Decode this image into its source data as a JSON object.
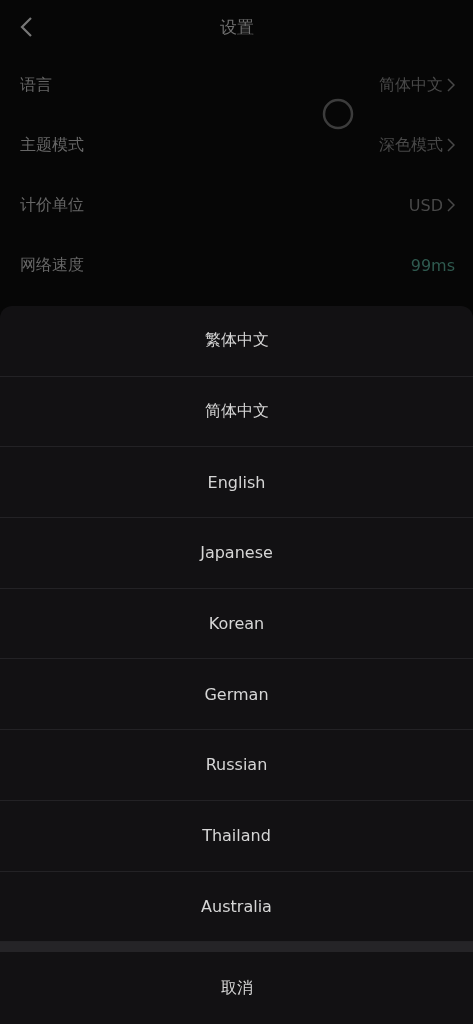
{
  "header": {
    "title": "设置"
  },
  "settings": [
    {
      "label": "语言",
      "value": "简体中文",
      "kind": "link"
    },
    {
      "label": "主题模式",
      "value": "深色模式",
      "kind": "link"
    },
    {
      "label": "计价单位",
      "value": "USD",
      "kind": "link"
    },
    {
      "label": "网络速度",
      "value": "99ms",
      "kind": "status"
    }
  ],
  "sheet": {
    "options": [
      "繁体中文",
      "简体中文",
      "English",
      "Japanese",
      "Korean",
      "German",
      "Russian",
      "Thailand",
      "Australia"
    ],
    "cancel": "取消"
  }
}
